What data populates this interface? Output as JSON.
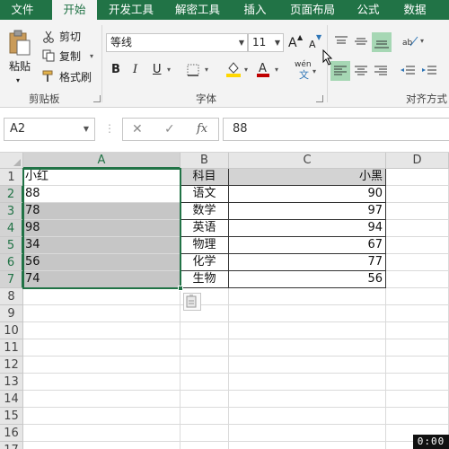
{
  "tabs": [
    {
      "label": "文件",
      "active": false
    },
    {
      "label": "开始",
      "active": true
    },
    {
      "label": "开发工具",
      "active": false
    },
    {
      "label": "解密工具",
      "active": false
    },
    {
      "label": "插入",
      "active": false
    },
    {
      "label": "页面布局",
      "active": false
    },
    {
      "label": "公式",
      "active": false
    },
    {
      "label": "数据",
      "active": false
    }
  ],
  "clipboard": {
    "paste_label": "粘贴",
    "cut_label": "剪切",
    "copy_label": "复制",
    "format_painter_label": "格式刷",
    "group_label": "剪贴板"
  },
  "font": {
    "font_name": "等线",
    "font_size": "11",
    "bold": "B",
    "italic": "I",
    "underline": "U",
    "grow": "A",
    "shrink": "A",
    "phonetic": "wén",
    "group_label": "字体"
  },
  "alignment": {
    "group_label": "对齐方式"
  },
  "formula_bar": {
    "name_box": "A2",
    "fx": "fx",
    "value": "88"
  },
  "columns": [
    "A",
    "B",
    "C",
    "D"
  ],
  "rows": [
    "1",
    "2",
    "3",
    "4",
    "5",
    "6",
    "7",
    "8",
    "9",
    "10",
    "11",
    "12",
    "13",
    "14",
    "15",
    "16",
    "17"
  ],
  "sheet": {
    "A": [
      "小红",
      "88",
      "78",
      "98",
      "34",
      "56",
      "74"
    ],
    "B": [
      "科目",
      "语文",
      "数学",
      "英语",
      "物理",
      "化学",
      "生物"
    ],
    "C": [
      "小黑",
      "90",
      "97",
      "94",
      "67",
      "77",
      "56"
    ]
  },
  "timer": "0:00",
  "colors": {
    "accent": "#217346",
    "selection_shade": "#c6c6c6",
    "header_shade": "#d3d3d3"
  }
}
